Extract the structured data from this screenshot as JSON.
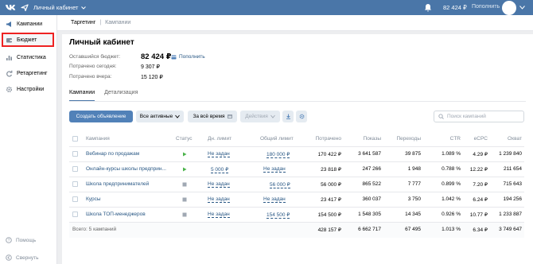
{
  "header": {
    "cabinet_label": "Личный кабинет",
    "balance": "82 424 ₽",
    "topup": "Пополнить"
  },
  "sidebar": {
    "items": [
      {
        "label": "Кампании"
      },
      {
        "label": "Бюджет"
      },
      {
        "label": "Статистика"
      },
      {
        "label": "Ретаргетинг"
      },
      {
        "label": "Настройки"
      }
    ],
    "help": "Помощь",
    "collapse": "Свернуть"
  },
  "breadcrumb": {
    "root": "Таргетинг",
    "current": "Кампании"
  },
  "page": {
    "title": "Личный кабинет",
    "budget_left_label": "Оставшийся бюджет:",
    "budget_left_value": "82 424 ₽",
    "topup_link": "Пополнить",
    "spent_today_label": "Потрачено сегодня:",
    "spent_today_value": "9 307 ₽",
    "spent_yesterday_label": "Потрачено вчера:",
    "spent_yesterday_value": "15 120 ₽"
  },
  "tabs": [
    {
      "label": "Кампании"
    },
    {
      "label": "Детализация"
    }
  ],
  "toolbar": {
    "create": "Создать объявление",
    "filter": "Все активные",
    "period": "За всё время",
    "actions": "Действия",
    "search_placeholder": "Поиск кампаний"
  },
  "table": {
    "headers": {
      "campaign": "Кампания",
      "status": "Статус",
      "daily": "Дн. лимит",
      "total": "Общий лимит",
      "spent": "Потрачено",
      "impressions": "Показы",
      "clicks": "Переходы",
      "ctr": "CTR",
      "ecpc": "eCPC",
      "reach": "Охват"
    },
    "rows": [
      {
        "name": "Вебинар по продажам",
        "status": "active",
        "daily": "Не задан",
        "total": "180 000 ₽",
        "spent": "170 422 ₽",
        "impressions": "3 641 587",
        "clicks": "39 875",
        "ctr": "1.089 %",
        "ecpc": "4.29 ₽",
        "reach": "1 239 840"
      },
      {
        "name": "Онлайн-курсы школы предприн...",
        "status": "active",
        "daily": "5 000 ₽",
        "total": "Не задан",
        "spent": "23 818 ₽",
        "impressions": "247 266",
        "clicks": "1 948",
        "ctr": "0.788 %",
        "ecpc": "12.22 ₽",
        "reach": "211 654"
      },
      {
        "name": "Школа предпринимателей",
        "status": "stopped",
        "daily": "Не задан",
        "total": "56 000 ₽",
        "spent": "56 000 ₽",
        "impressions": "865 522",
        "clicks": "7 777",
        "ctr": "0.899 %",
        "ecpc": "7.20 ₽",
        "reach": "715 643"
      },
      {
        "name": "Курсы",
        "status": "stopped",
        "daily": "Не задан",
        "total": "Не задан",
        "spent": "23 417 ₽",
        "impressions": "360 037",
        "clicks": "3 750",
        "ctr": "1.042 %",
        "ecpc": "6.24 ₽",
        "reach": "194 256"
      },
      {
        "name": "Школа ТОП-менеджеров",
        "status": "stopped",
        "daily": "Не задан",
        "total": "154 500 ₽",
        "spent": "154 500 ₽",
        "impressions": "1 548 305",
        "clicks": "14 345",
        "ctr": "0.926 %",
        "ecpc": "10.77 ₽",
        "reach": "1 233 887"
      }
    ],
    "footer": {
      "label": "Всего: 5 кампаний",
      "spent": "428 157 ₽",
      "impressions": "6 662 717",
      "clicks": "67 495",
      "ctr": "1.013 %",
      "ecpc": "6.34 ₽",
      "reach": "3 749 647"
    }
  },
  "colors": {
    "header_bg": "#4a76a8",
    "primary_button": "#5181b8",
    "link": "#2a5885",
    "active_status": "#4bb34b",
    "stopped_status": "#a0a8b3",
    "highlight_border": "#ee2222"
  }
}
